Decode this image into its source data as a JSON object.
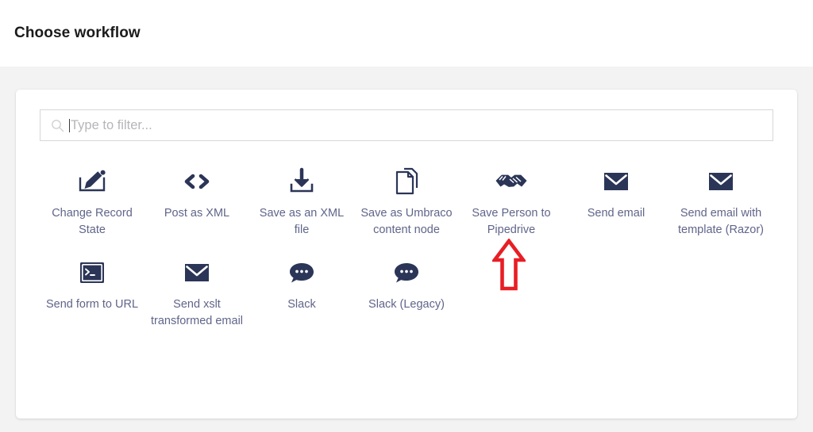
{
  "header": {
    "title": "Choose workflow"
  },
  "search": {
    "placeholder": "Type to filter...",
    "value": "",
    "icon": "search-icon"
  },
  "colors": {
    "page_background": "#f4f3f3",
    "card_background": "#ffffff",
    "icon": "#2b3557",
    "label": "#60658a",
    "title": "#1b1b1b",
    "annotation": "#e81e25"
  },
  "workflows": [
    {
      "label": "Change Record State",
      "icon": "edit-box-icon"
    },
    {
      "label": "Post as XML",
      "icon": "code-brackets-icon"
    },
    {
      "label": "Save as an XML file",
      "icon": "download-tray-icon"
    },
    {
      "label": "Save as Umbraco content node",
      "icon": "copy-documents-icon"
    },
    {
      "label": "Save Person to Pipedrive",
      "icon": "handshake-icon"
    },
    {
      "label": "Send email",
      "icon": "envelope-icon"
    },
    {
      "label": "Send email with template (Razor)",
      "icon": "envelope-icon"
    },
    {
      "label": "Send form to URL",
      "icon": "terminal-icon"
    },
    {
      "label": "Send xslt transformed email",
      "icon": "envelope-icon"
    },
    {
      "label": "Slack",
      "icon": "speech-bubble-icon"
    },
    {
      "label": "Slack (Legacy)",
      "icon": "speech-bubble-icon"
    }
  ],
  "annotation": {
    "type": "arrow-up",
    "points_at": "Save Person to Pipedrive",
    "color": "#e81e25"
  }
}
